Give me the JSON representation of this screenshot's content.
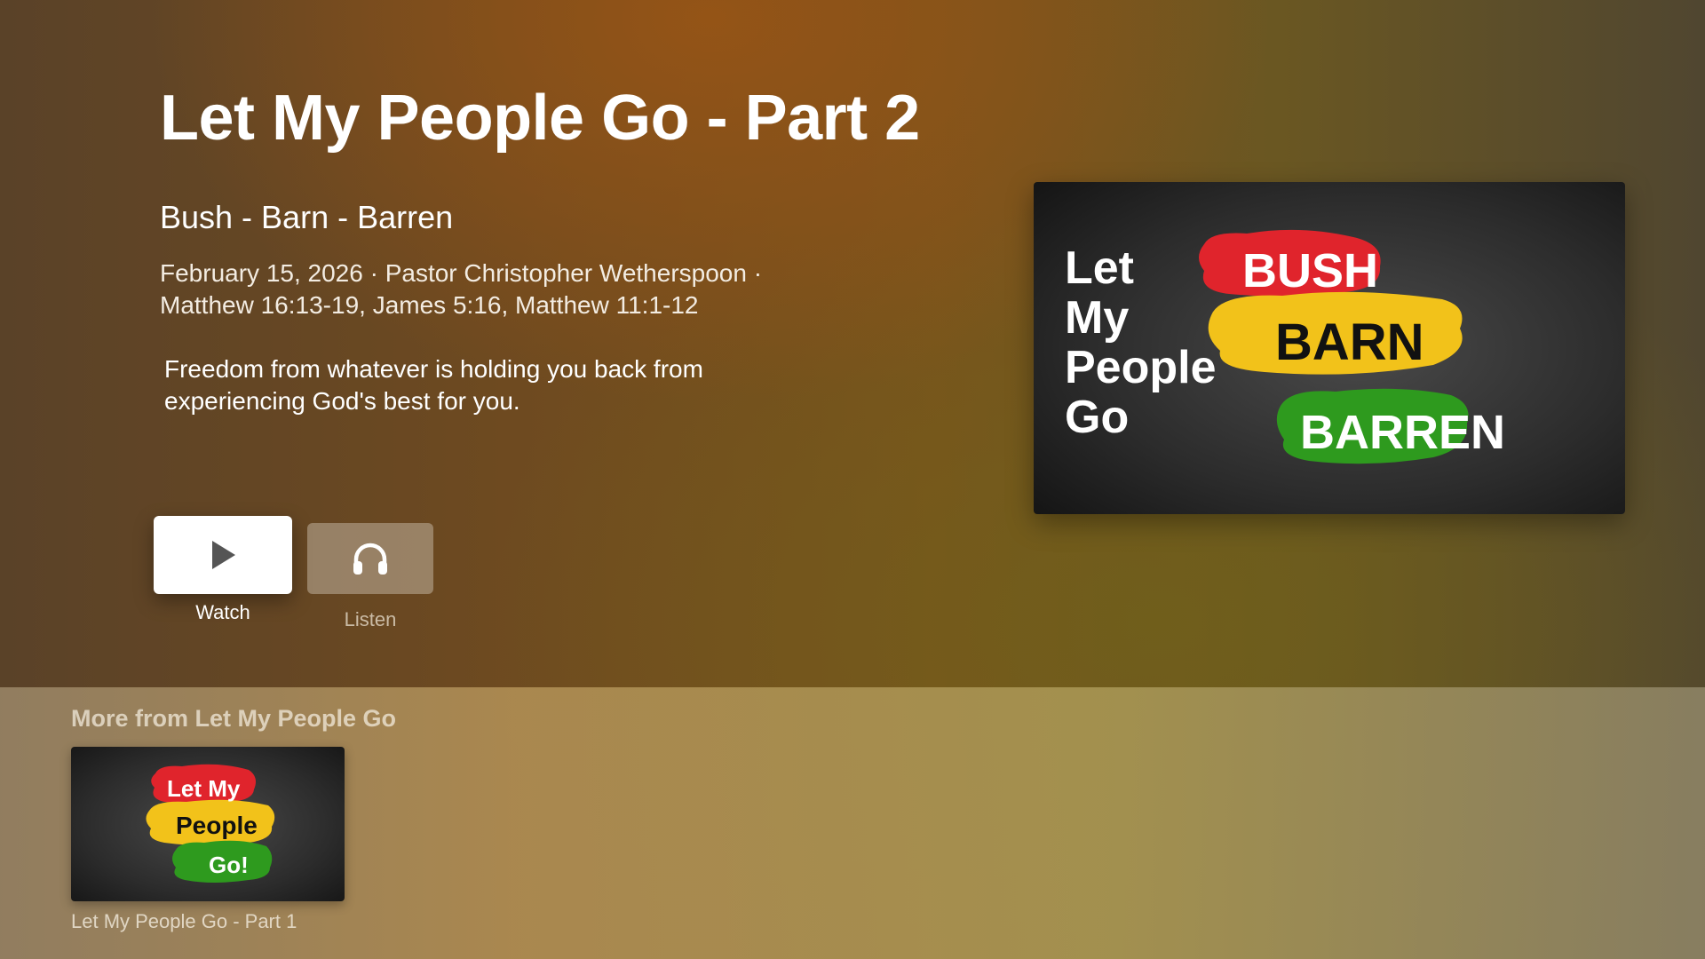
{
  "sermon": {
    "title": "Let My People Go - Part 2",
    "subtitle": "Bush - Barn - Barren",
    "meta_line1": "February 15, 2026 · Pastor Christopher Wetherspoon ·",
    "meta_line2": "Matthew 16:13-19, James 5:16, Matthew 11:1-12",
    "description": "Freedom from whatever is holding you back from experiencing God's best for you."
  },
  "actions": {
    "watch": {
      "label": "Watch",
      "icon": "play-icon"
    },
    "listen": {
      "label": "Listen",
      "icon": "headphones-icon"
    }
  },
  "hero_artwork": {
    "left_words": [
      "Let",
      "My",
      "People",
      "Go"
    ],
    "bush": "BUSH",
    "barn": "BARN",
    "barren": "BARREN"
  },
  "more": {
    "heading": "More from Let My People Go",
    "items": [
      {
        "label": "Let My People Go - Part 1",
        "art_line1": "Let My",
        "art_line2": "People",
        "art_line3": "Go!"
      }
    ]
  },
  "colors": {
    "brush_red": "#e0242c",
    "brush_yellow": "#f2c21a",
    "brush_green": "#2e9a1e",
    "art_background": "#2a2a2a"
  }
}
